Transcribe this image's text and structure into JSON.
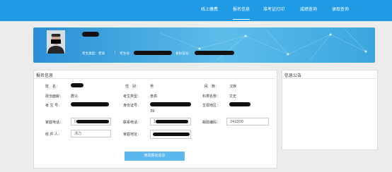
{
  "nav": {
    "items": [
      "线上缴费",
      "报名信息",
      "准考证打印",
      "成绩查询",
      "录取查询"
    ],
    "active_index": 1
  },
  "profile": {
    "name_redacted": true,
    "student_type_label": "考生类型：普高",
    "exam_no_label": "考生号：",
    "id_no_label": "身份证号："
  },
  "registration": {
    "title": "报名信息",
    "fields": {
      "name_label": "姓　名：",
      "gender_label": "性　别：",
      "gender_value": "男",
      "ethnicity_label": "民　族：",
      "ethnicity_value": "汉族",
      "politics_label": "政治面貌：",
      "politics_value": "群众",
      "student_type_label": "考生类型：",
      "student_type_value": "普高",
      "subject_label": "科类名称：",
      "subject_value": "文史",
      "exam_no_label": "考 生 号：",
      "id_no_label": "身份证号：",
      "id_no_suffix": "39",
      "birthplace_label": "生源地区：",
      "home_phone_label": "家庭电话：",
      "home_phone_prefix": "0",
      "contact_phone_label": "联系电话：",
      "contact_phone_prefix": "1",
      "postcode_label": "邮政编码：",
      "postcode_value": "242300",
      "recipient_label": "收 件 人：",
      "recipient_value": "汤力",
      "address_label": "家庭地址："
    },
    "edit_button": "修改报名信息"
  },
  "notice": {
    "title": "信息公告"
  }
}
